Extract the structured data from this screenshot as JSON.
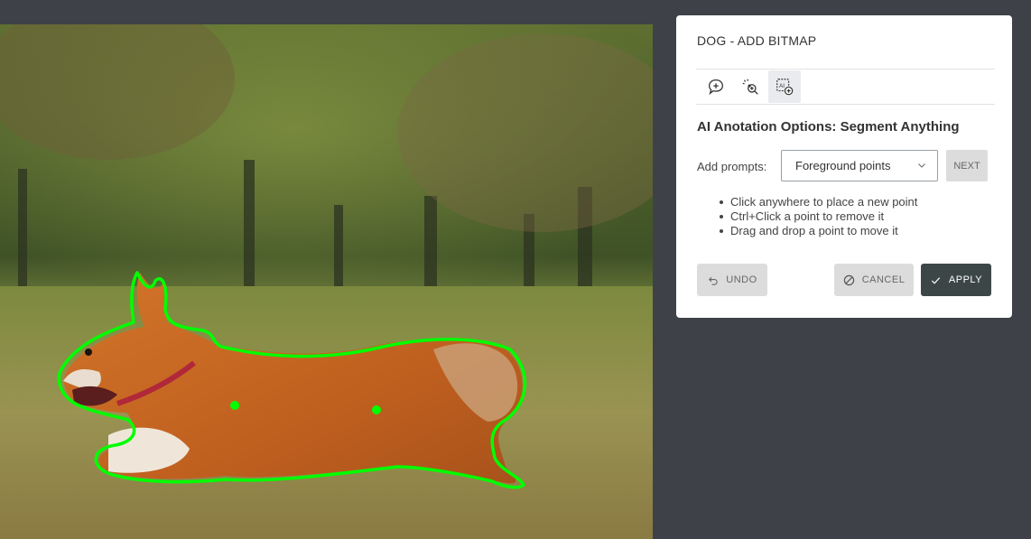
{
  "panel": {
    "title": "DOG - ADD BITMAP",
    "tools": [
      {
        "icon": "chat-plus-icon",
        "active": false
      },
      {
        "icon": "magic-cursor-icon",
        "active": false
      },
      {
        "icon": "ai-add-icon",
        "active": true
      }
    ],
    "options_title": "AI Anotation Options: Segment Anything",
    "prompt_label": "Add prompts:",
    "prompt_select_value": "Foreground points",
    "next_label": "NEXT",
    "hints": [
      "Click anywhere to place a new point",
      "Ctrl+Click a point to remove it",
      "Drag and drop a point to move it"
    ],
    "undo_label": "UNDO",
    "cancel_label": "CANCEL",
    "apply_label": "APPLY"
  },
  "colors": {
    "outline": "#00ff00",
    "apply_bg": "#3d4646",
    "background": "#3e4248"
  }
}
